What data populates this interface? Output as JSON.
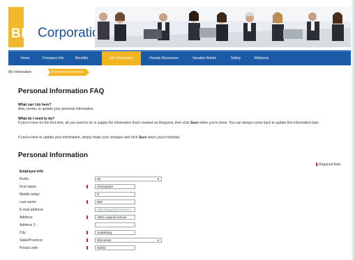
{
  "header": {
    "logo_bell": "BELL",
    "logo_corp": "Corporation"
  },
  "nav": {
    "items": [
      {
        "label": "Home"
      },
      {
        "label": "Company Info"
      },
      {
        "label": "Benefits"
      },
      {
        "label": "My Information"
      },
      {
        "label": "Human Resources"
      },
      {
        "label": "Vacation Admin"
      },
      {
        "label": "Safety"
      },
      {
        "label": "Wellness"
      }
    ],
    "active": "My Information",
    "bar_color": "#1b5aa6",
    "active_color": "#f3b621"
  },
  "breadcrumb": {
    "root": "My Information",
    "current": "Personal Information"
  },
  "faq": {
    "title": "Personal Information FAQ",
    "q1": "What can I do here?",
    "a1": "Add, review, or update your personal information.",
    "q2": "What do I need to do?",
    "a2_part1": "If you're here for the first time, all you need to do is supply the information that's marked as Required, then click ",
    "a2_save": "Save",
    "a2_part2": " when you're done. You can always come back to update this information later.",
    "a3_part1": "If you're here to update your information, simply make your changes and click ",
    "a3_save": "Save",
    "a3_part2": " when you're finished."
  },
  "form": {
    "title": "Personal Information",
    "required_legend": "Required field",
    "section": "Employee Info",
    "fields": [
      {
        "label": "Prefix:",
        "value": "Mr.",
        "type": "select",
        "required": false
      },
      {
        "label": "First name:",
        "value": "Christopher",
        "type": "text",
        "required": true
      },
      {
        "label": "Middle Initial:",
        "value": "R",
        "type": "text",
        "required": false
      },
      {
        "label": "Last name:",
        "value": "Bell",
        "type": "text",
        "required": true
      },
      {
        "label": "E-mail address:",
        "value": "matt.duggan@conexe.io",
        "type": "text",
        "required": false
      },
      {
        "label": "Address:",
        "value": "1862 Legend Avenue",
        "type": "text",
        "required": true
      },
      {
        "label": "Address 2:",
        "value": "",
        "type": "text",
        "required": false
      },
      {
        "label": "City:",
        "value": "Cedarburg",
        "type": "text",
        "required": true
      },
      {
        "label": "State/Province:",
        "value": "Wisconsin",
        "type": "select",
        "required": true
      },
      {
        "label": "Postal code:",
        "value": "53024",
        "type": "text",
        "required": true
      }
    ]
  }
}
